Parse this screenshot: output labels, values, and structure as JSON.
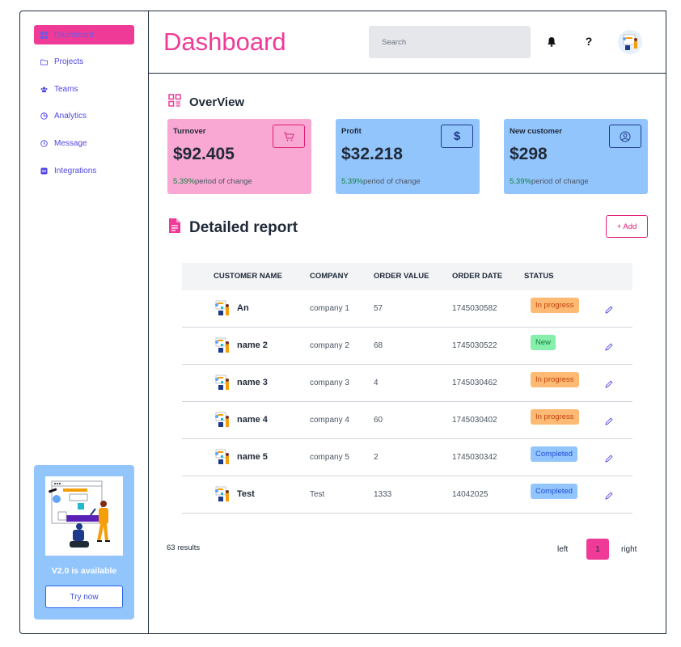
{
  "sidebar": {
    "items": [
      {
        "label": "Dashboard",
        "icon": "grid-icon",
        "active": true
      },
      {
        "label": "Projects",
        "icon": "folder-icon",
        "active": false
      },
      {
        "label": "Teams",
        "icon": "users-icon",
        "active": false
      },
      {
        "label": "Analytics",
        "icon": "pie-chart-icon",
        "active": false
      },
      {
        "label": "Message",
        "icon": "clock-icon",
        "active": false
      },
      {
        "label": "Integrations",
        "icon": "integrations-icon",
        "active": false
      }
    ],
    "promo": {
      "version_text": "V2.0 is available",
      "button_label": "Try now"
    }
  },
  "header": {
    "title": "Dashboard",
    "search_placeholder": "Search",
    "help_label": "?"
  },
  "overview": {
    "title": "OverView",
    "cards": [
      {
        "label": "Turnover",
        "value": "$92.405",
        "pct": "5.39%",
        "change_text": "period of change",
        "icon": "cart-icon",
        "bg": "#f9a8d4",
        "accent": "#e11d74"
      },
      {
        "label": "Profit",
        "value": "$32.218",
        "pct": "5.39%",
        "change_text": "period of change",
        "icon": "dollar-icon",
        "bg": "#93c5fd",
        "accent": "#1e3a8a"
      },
      {
        "label": "New customer",
        "value": "$298",
        "pct": "5.39%",
        "change_text": "period of change",
        "icon": "user-circle-icon",
        "bg": "#93c5fd",
        "accent": "#1e3a8a"
      }
    ]
  },
  "report": {
    "title": "Detailed report",
    "add_label": "+ Add",
    "columns": [
      "CUSTOMER NAME",
      "COMPANY",
      "ORDER VALUE",
      "ORDER DATE",
      "STATUS"
    ],
    "rows": [
      {
        "name": "An",
        "company": "company 1",
        "order_value": "57",
        "order_date": "1745030582",
        "status": "In progress"
      },
      {
        "name": "name 2",
        "company": "company 2",
        "order_value": "68",
        "order_date": "1745030522",
        "status": "New"
      },
      {
        "name": "name 3",
        "company": "company 3",
        "order_value": "4",
        "order_date": "1745030462",
        "status": "In progress"
      },
      {
        "name": "name 4",
        "company": "company 4",
        "order_value": "60",
        "order_date": "1745030402",
        "status": "In progress"
      },
      {
        "name": "name 5",
        "company": "company 5",
        "order_value": "2",
        "order_date": "1745030342",
        "status": "Completed"
      },
      {
        "name": "Test",
        "company": "Test",
        "order_value": "1333",
        "order_date": "14042025",
        "status": "Completed"
      }
    ],
    "status_colors": {
      "In progress": {
        "bg": "#fdba74",
        "fg": "#c2410c"
      },
      "New": {
        "bg": "#86efac",
        "fg": "#15803d"
      },
      "Completed": {
        "bg": "#93c5fd",
        "fg": "#1d4ed8"
      }
    }
  },
  "footer": {
    "results": "63 results",
    "prev_label": "left",
    "page": "1",
    "next_label": "right"
  }
}
